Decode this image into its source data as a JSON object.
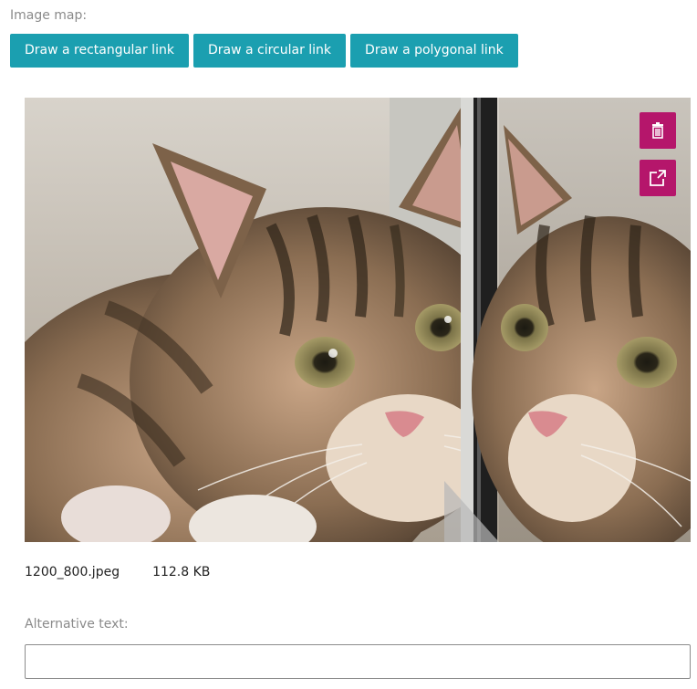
{
  "image_map": {
    "label": "Image map:",
    "buttons": {
      "rect": "Draw a rectangular link",
      "circle": "Draw a circular link",
      "polygon": "Draw a polygonal link"
    }
  },
  "image": {
    "subject": "tabby kitten beside a mirror",
    "actions": {
      "delete_icon": "trash-icon",
      "expand_icon": "expand-icon"
    },
    "action_color": "#b5166b"
  },
  "file": {
    "name": "1200_800.jpeg",
    "size": "112.8 KB"
  },
  "alt_text": {
    "label": "Alternative text:",
    "value": ""
  },
  "colors": {
    "button_bg": "#1b9fb0",
    "label_text": "#8a8a8a"
  }
}
